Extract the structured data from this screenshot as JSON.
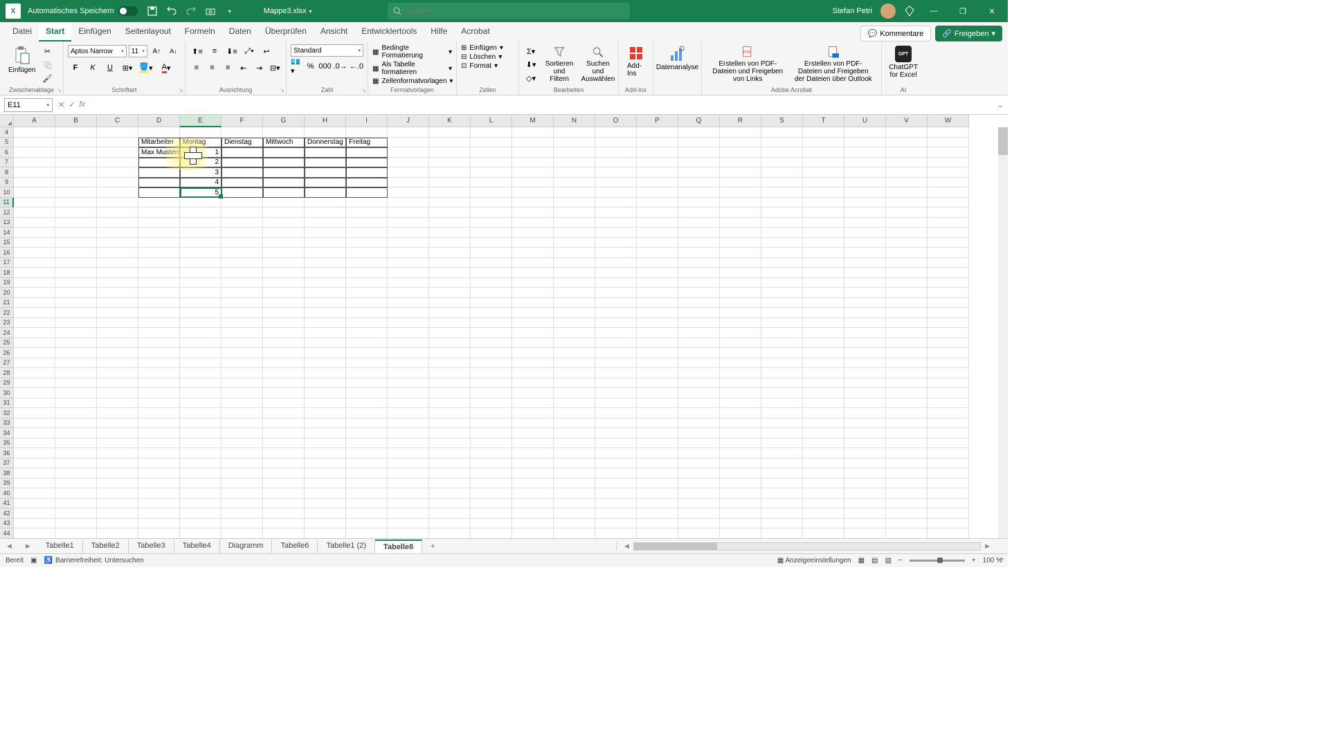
{
  "titlebar": {
    "autosave_label": "Automatisches Speichern",
    "filename": "Mappe3.xlsx",
    "search_placeholder": "Suchen",
    "username": "Stefan Petri"
  },
  "tabs": {
    "items": [
      "Datei",
      "Start",
      "Einfügen",
      "Seitenlayout",
      "Formeln",
      "Daten",
      "Überprüfen",
      "Ansicht",
      "Entwicklertools",
      "Hilfe",
      "Acrobat"
    ],
    "active": "Start",
    "comments": "Kommentare",
    "share": "Freigeben"
  },
  "ribbon": {
    "clipboard": {
      "paste": "Einfügen",
      "label": "Zwischenablage"
    },
    "font": {
      "name": "Aptos Narrow",
      "size": "11",
      "bold": "F",
      "italic": "K",
      "underline": "U",
      "label": "Schriftart"
    },
    "align": {
      "label": "Ausrichtung"
    },
    "number": {
      "fmt": "Standard",
      "label": "Zahl"
    },
    "styles": {
      "cond": "Bedingte Formatierung",
      "table": "Als Tabelle formatieren",
      "cellstyles": "Zellenformatvorlagen",
      "label": "Formatvorlagen"
    },
    "cells": {
      "ins": "Einfügen",
      "del": "Löschen",
      "fmt": "Format",
      "label": "Zellen"
    },
    "editing": {
      "sort": "Sortieren und Filtern",
      "find": "Suchen und Auswählen",
      "label": "Bearbeiten"
    },
    "addins": {
      "btn": "Add-Ins",
      "label": "Add-Ins"
    },
    "analysis": {
      "btn": "Datenanalyse"
    },
    "acrobat": {
      "links": "Erstellen von PDF-Dateien und Freigeben von Links",
      "outlook": "Erstellen von PDF-Dateien und Freigeben der Dateien über Outlook",
      "label": "Adobe Acrobat"
    },
    "ai": {
      "btn": "ChatGPT for Excel",
      "label": "AI"
    }
  },
  "formula": {
    "cell": "E11"
  },
  "grid": {
    "cols": [
      "A",
      "B",
      "C",
      "D",
      "E",
      "F",
      "G",
      "H",
      "I",
      "J",
      "K",
      "L",
      "M",
      "N",
      "O",
      "P",
      "Q",
      "R",
      "S",
      "T",
      "U",
      "V",
      "W"
    ],
    "row_start": 4,
    "row_end": 45,
    "headers": [
      "Mitarbeiter",
      "Montag",
      "Dienstag",
      "Mittwoch",
      "Donnerstag",
      "Freitag"
    ],
    "employee": "Max Musterm",
    "vals": [
      "1",
      "2",
      "3",
      "4",
      "5"
    ],
    "sel_col": "E",
    "sel_row": 11
  },
  "sheets": {
    "items": [
      "Tabelle1",
      "Tabelle2",
      "Tabelle3",
      "Tabelle4",
      "Diagramm",
      "Tabelle6",
      "Tabelle1 (2)",
      "Tabelle8"
    ],
    "active": "Tabelle8"
  },
  "status": {
    "ready": "Bereit",
    "access": "Barrierefreiheit: Untersuchen",
    "display": "Anzeigeeinstellungen",
    "zoom": "100 %"
  }
}
